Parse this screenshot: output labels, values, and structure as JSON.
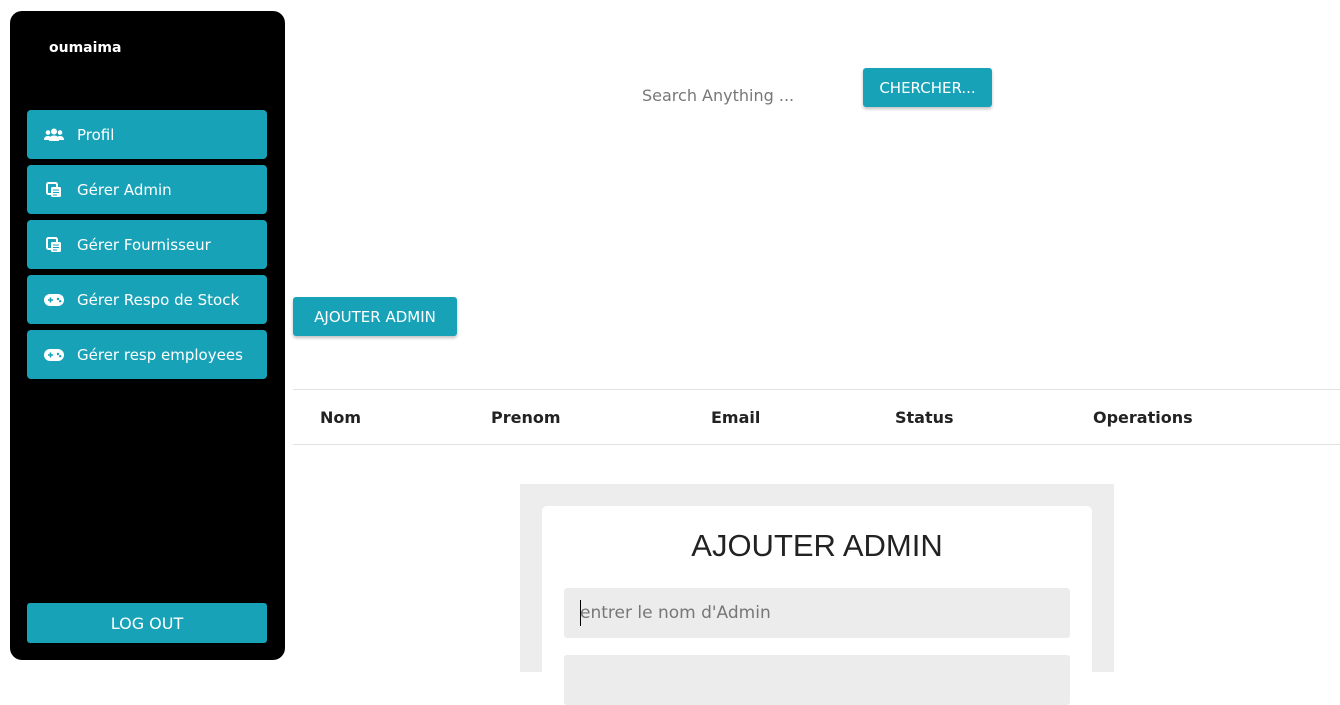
{
  "sidebar": {
    "brand": "oumaima",
    "items": [
      {
        "label": "Profil",
        "icon": "users-icon"
      },
      {
        "label": "Gérer Admin",
        "icon": "copy-icon"
      },
      {
        "label": "Gérer Fournisseur",
        "icon": "copy-icon"
      },
      {
        "label": "Gérer Respo de Stock",
        "icon": "gamepad-icon"
      },
      {
        "label": "Gérer resp employees",
        "icon": "gamepad-icon"
      }
    ],
    "logout_label": "LOG OUT"
  },
  "search": {
    "placeholder": "Search Anything ...",
    "button_label": "CHERCHER..."
  },
  "add_button_label": "AJOUTER ADMIN",
  "table": {
    "headers": [
      "Nom",
      "Prenom",
      "Email",
      "Status",
      "Operations"
    ]
  },
  "modal": {
    "title": "AJOUTER ADMIN",
    "name_placeholder": "entrer le nom d'Admin",
    "second_placeholder": ""
  },
  "colors": {
    "accent": "#17a2b8",
    "sidebar_bg": "#000000"
  }
}
